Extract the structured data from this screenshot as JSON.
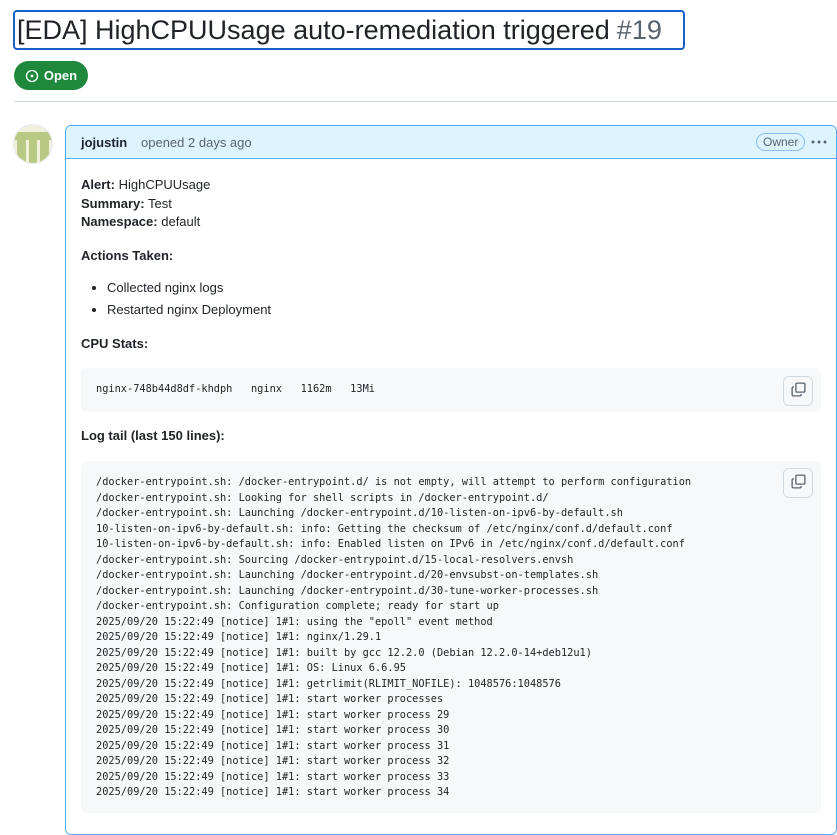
{
  "issue": {
    "title": "[EDA] HighCPUUsage auto-remediation triggered",
    "number": "#19",
    "state": "Open"
  },
  "comment": {
    "author": "jojustin",
    "opened_text": "opened",
    "time_ago": "2 days ago",
    "role_badge": "Owner",
    "alert_label": "Alert:",
    "alert_value": "HighCPUUsage",
    "summary_label": "Summary:",
    "summary_value": "Test",
    "namespace_label": "Namespace:",
    "namespace_value": "default",
    "actions_heading": "Actions Taken:",
    "actions": [
      "Collected nginx logs",
      "Restarted nginx Deployment"
    ],
    "cpu_heading": "CPU Stats:",
    "cpu_stats": "nginx-748b44d8df-khdph   nginx   1162m   13Mi",
    "log_heading": "Log tail (last 150 lines):",
    "log_lines": [
      "/docker-entrypoint.sh: /docker-entrypoint.d/ is not empty, will attempt to perform configuration",
      "/docker-entrypoint.sh: Looking for shell scripts in /docker-entrypoint.d/",
      "/docker-entrypoint.sh: Launching /docker-entrypoint.d/10-listen-on-ipv6-by-default.sh",
      "10-listen-on-ipv6-by-default.sh: info: Getting the checksum of /etc/nginx/conf.d/default.conf",
      "10-listen-on-ipv6-by-default.sh: info: Enabled listen on IPv6 in /etc/nginx/conf.d/default.conf",
      "/docker-entrypoint.sh: Sourcing /docker-entrypoint.d/15-local-resolvers.envsh",
      "/docker-entrypoint.sh: Launching /docker-entrypoint.d/20-envsubst-on-templates.sh",
      "/docker-entrypoint.sh: Launching /docker-entrypoint.d/30-tune-worker-processes.sh",
      "/docker-entrypoint.sh: Configuration complete; ready for start up",
      "2025/09/20 15:22:49 [notice] 1#1: using the \"epoll\" event method",
      "2025/09/20 15:22:49 [notice] 1#1: nginx/1.29.1",
      "2025/09/20 15:22:49 [notice] 1#1: built by gcc 12.2.0 (Debian 12.2.0-14+deb12u1)",
      "2025/09/20 15:22:49 [notice] 1#1: OS: Linux 6.6.95",
      "2025/09/20 15:22:49 [notice] 1#1: getrlimit(RLIMIT_NOFILE): 1048576:1048576",
      "2025/09/20 15:22:49 [notice] 1#1: start worker processes",
      "2025/09/20 15:22:49 [notice] 1#1: start worker process 29",
      "2025/09/20 15:22:49 [notice] 1#1: start worker process 30",
      "2025/09/20 15:22:49 [notice] 1#1: start worker process 31",
      "2025/09/20 15:22:49 [notice] 1#1: start worker process 32",
      "2025/09/20 15:22:49 [notice] 1#1: start worker process 33",
      "2025/09/20 15:22:49 [notice] 1#1: start worker process 34"
    ]
  },
  "icons": {
    "state": "issue-opened-icon",
    "menu": "kebab-horizontal-icon",
    "copy": "copy-icon"
  },
  "colors": {
    "open_green": "#1f883d",
    "header_bg": "#ddf4ff",
    "header_border": "#54aeff",
    "title_focus": "#1b5fcc",
    "code_bg": "#f6f8fa"
  }
}
